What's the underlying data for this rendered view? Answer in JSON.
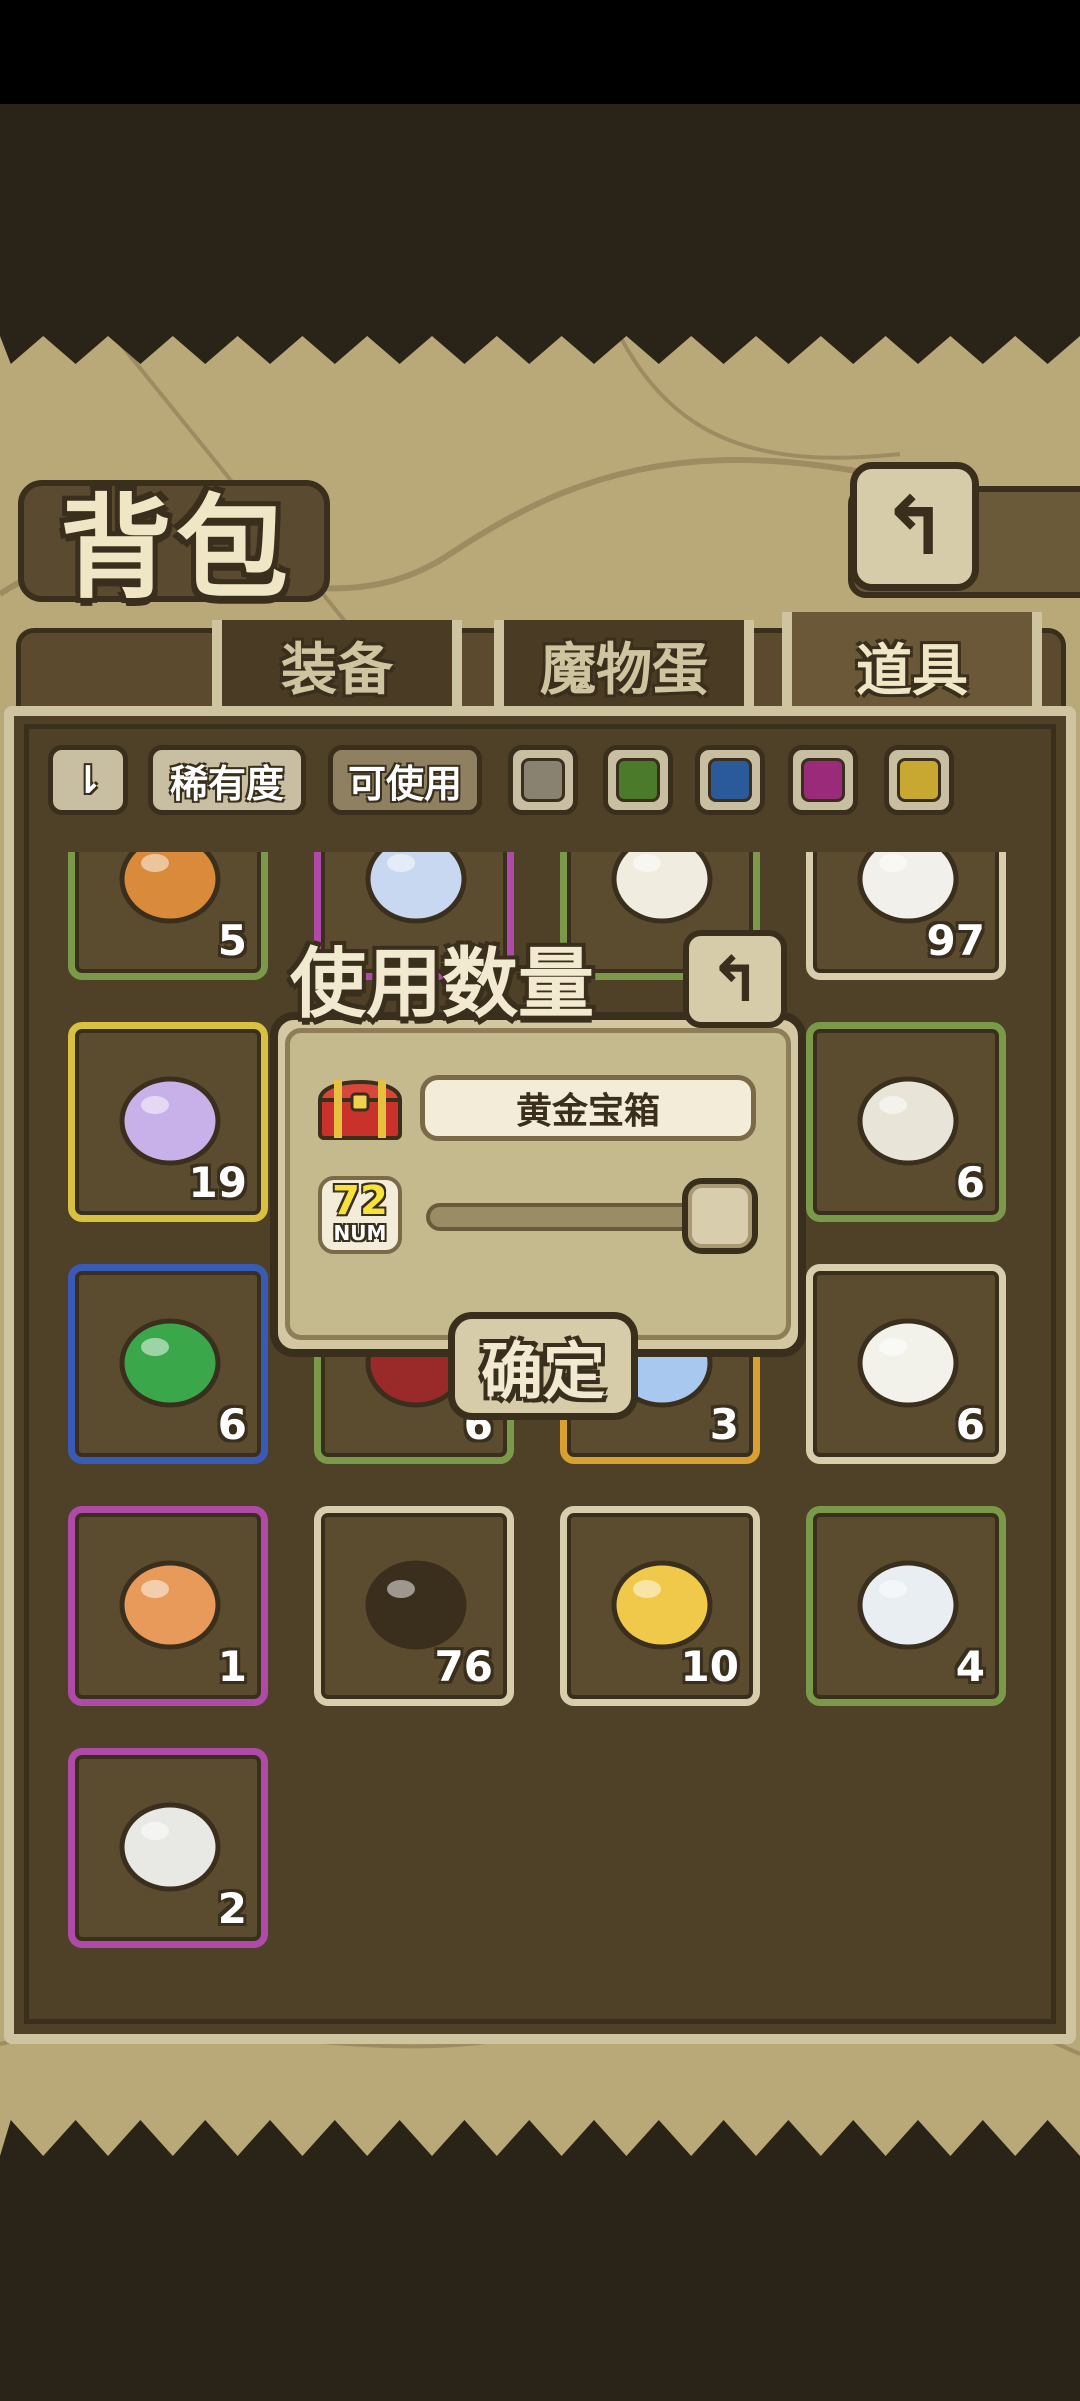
{
  "header": {
    "title": "背包",
    "back_icon": "↰"
  },
  "tabs": [
    {
      "label": "装备",
      "active": false
    },
    {
      "label": "魔物蛋",
      "active": false
    },
    {
      "label": "道具",
      "active": true
    }
  ],
  "filters": {
    "sort_icon": "⇂",
    "rarity_label": "稀有度",
    "usable_label": "可使用",
    "colors": [
      "#8a8270",
      "#4a7a2a",
      "#2a5a9a",
      "#9a2a7a",
      "#c8a830"
    ]
  },
  "items": [
    {
      "count": "5",
      "border": "#7a9a4a",
      "icon": "mooncake-icon",
      "color": "#d98a3a"
    },
    {
      "count": "",
      "border": "#b04aa8",
      "icon": "rainbow-egg-icon",
      "color": "#c8d8f0"
    },
    {
      "count": "",
      "border": "#7a9a4a",
      "icon": "bean-pile-icon",
      "color": "#f0ece0"
    },
    {
      "count": "97",
      "border": "#d8ceae",
      "icon": "seed-bag-icon",
      "color": "#f2f0ea"
    },
    {
      "count": "19",
      "border": "#d8c040",
      "icon": "winged-lantern-icon",
      "color": "#c8b0e8"
    },
    {
      "count": "",
      "border": "#d8ceae",
      "icon": "hidden-item-icon",
      "color": "#5b4c30"
    },
    {
      "count": "",
      "border": "#d8ceae",
      "icon": "hidden-item-icon",
      "color": "#5b4c30"
    },
    {
      "count": "6",
      "border": "#7a9a4a",
      "icon": "rice-dumpling-icon",
      "color": "#e8e4d8"
    },
    {
      "count": "6",
      "border": "#3a5ab8",
      "icon": "green-zongzi-icon",
      "color": "#3aa84a"
    },
    {
      "count": "6",
      "border": "#7a9a4a",
      "icon": "red-fruit-icon",
      "color": "#9a2a2a"
    },
    {
      "count": "3",
      "border": "#d8a030",
      "icon": "ghost-box-icon",
      "color": "#a8c8f0"
    },
    {
      "count": "6",
      "border": "#d8ceae",
      "icon": "radish-icon",
      "color": "#f2f2ea"
    },
    {
      "count": "1",
      "border": "#b04aa8",
      "icon": "bear-girl-figure-icon",
      "color": "#e89a5a"
    },
    {
      "count": "76",
      "border": "#d8ceae",
      "icon": "pie-icon",
      "color": "#3a2e1c"
    },
    {
      "count": "10",
      "border": "#d8ceae",
      "icon": "rainbow-orb-icon",
      "color": "#f0c84a"
    },
    {
      "count": "4",
      "border": "#7a9a4a",
      "icon": "paw-bowl-icon",
      "color": "#e8eef2"
    },
    {
      "count": "2",
      "border": "#b04aa8",
      "icon": "white-ball-icon",
      "color": "#e8e8e4"
    }
  ],
  "dialog": {
    "title": "使用数量",
    "back_icon": "↰",
    "item_name": "黄金宝箱",
    "chest_icon": "treasure-chest-icon",
    "quantity": "72",
    "quantity_label": "NUM",
    "slider_fraction": 1.0,
    "confirm_label": "确定"
  }
}
